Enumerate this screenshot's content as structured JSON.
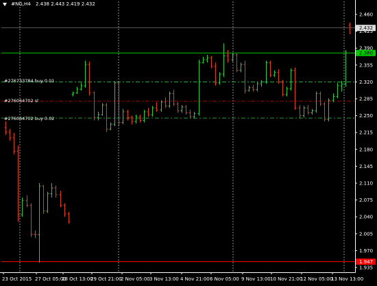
{
  "window": {
    "symbol": "#NG,H4",
    "ohlc": "2.438 2.443 2.419 2.432"
  },
  "colors": {
    "background": "#000000",
    "bull": "#2ecc40",
    "bear": "#e04020",
    "axis": "#ffffff",
    "order_line": "#2ecc40",
    "sl_line": "#cc0000",
    "current_line": "#e04020",
    "bid_line": "#00cc00",
    "ask_line": "#ff0000"
  },
  "order_lines": [
    {
      "label": "#276733784 buy 0.01",
      "price": 2.32,
      "kind": "order"
    },
    {
      "label": "#276064702 sl",
      "price": 2.28,
      "kind": "sl"
    },
    {
      "label": "#276064702 buy 0.02",
      "price": 2.245,
      "kind": "order"
    }
  ],
  "price_tags": {
    "current": {
      "text": "2.432",
      "price": 2.432
    },
    "green": {
      "text": "2.380",
      "price": 2.38
    },
    "red": {
      "text": "1.947",
      "price": 1.947
    }
  },
  "chart_data": {
    "type": "candlestick",
    "ylim": [
      1.925,
      2.47
    ],
    "y_ticks": [
      "2.460",
      "2.425",
      "2.390",
      "2.355",
      "2.320",
      "2.285",
      "2.250",
      "2.215",
      "2.180",
      "2.145",
      "2.110",
      "2.075",
      "2.040",
      "2.005",
      "1.970",
      "1.935"
    ],
    "x_labels": [
      "23 Oct 2015",
      "27 Oct 05:00",
      "28 Oct 13:00",
      "29 Oct 21:00",
      "2 Nov 05:00",
      "3 Nov 13:00",
      "4 Nov 21:00",
      "6 Nov 05:00",
      "9 Nov 13:00",
      "10 Nov 21:00",
      "12 Nov 05:00",
      "13 Nov 13:00"
    ],
    "period_separators": [
      "26 Oct 2015 00:00",
      "2 Nov 2015 00:00",
      "9 Nov 2015 00:00",
      "16 Nov 2015 00:00"
    ],
    "candles": [
      [
        2.225,
        2.238,
        2.21,
        2.216
      ],
      [
        2.216,
        2.222,
        2.198,
        2.204
      ],
      [
        2.204,
        2.214,
        2.17,
        2.176
      ],
      [
        2.176,
        2.188,
        2.03,
        2.045
      ],
      [
        2.045,
        2.08,
        2.04,
        2.074
      ],
      [
        2.074,
        2.085,
        2.06,
        2.064
      ],
      [
        2.064,
        2.068,
        1.998,
        2.004
      ],
      [
        2.004,
        2.012,
        1.996,
        2.003
      ],
      [
        2.003,
        2.11,
        1.945,
        2.104
      ],
      [
        2.104,
        2.106,
        2.046,
        2.052
      ],
      [
        2.052,
        2.092,
        2.048,
        2.088
      ],
      [
        2.088,
        2.11,
        2.08,
        2.1
      ],
      [
        2.1,
        2.105,
        2.08,
        2.086
      ],
      [
        2.086,
        2.094,
        2.06,
        2.064
      ],
      [
        2.064,
        2.068,
        2.04,
        2.046
      ],
      [
        2.046,
        2.05,
        2.026,
        2.03
      ],
      [
        2.294,
        2.3,
        2.29,
        2.297
      ],
      [
        2.297,
        2.31,
        2.295,
        2.305
      ],
      [
        2.305,
        2.318,
        2.302,
        2.312
      ],
      [
        2.312,
        2.364,
        2.308,
        2.356
      ],
      [
        2.356,
        2.362,
        2.292,
        2.298
      ],
      [
        2.298,
        2.3,
        2.24,
        2.246
      ],
      [
        2.246,
        2.258,
        2.24,
        2.252
      ],
      [
        2.252,
        2.276,
        2.25,
        2.272
      ],
      [
        2.272,
        2.276,
        2.216,
        2.222
      ],
      [
        2.222,
        2.236,
        2.22,
        2.232
      ],
      [
        2.232,
        2.322,
        2.228,
        2.318
      ],
      [
        2.318,
        2.322,
        2.228,
        2.236
      ],
      [
        2.236,
        2.264,
        2.232,
        2.258
      ],
      [
        2.258,
        2.262,
        2.24,
        2.246
      ],
      [
        2.246,
        2.25,
        2.232,
        2.238
      ],
      [
        2.238,
        2.252,
        2.234,
        2.248
      ],
      [
        2.248,
        2.252,
        2.236,
        2.24
      ],
      [
        2.24,
        2.262,
        2.236,
        2.258
      ],
      [
        2.258,
        2.266,
        2.248,
        2.252
      ],
      [
        2.252,
        2.27,
        2.248,
        2.266
      ],
      [
        2.266,
        2.278,
        2.258,
        2.262
      ],
      [
        2.262,
        2.282,
        2.258,
        2.278
      ],
      [
        2.278,
        2.288,
        2.266,
        2.27
      ],
      [
        2.27,
        2.3,
        2.266,
        2.296
      ],
      [
        2.296,
        2.304,
        2.27,
        2.274
      ],
      [
        2.274,
        2.278,
        2.256,
        2.26
      ],
      [
        2.26,
        2.272,
        2.256,
        2.268
      ],
      [
        2.268,
        2.272,
        2.252,
        2.256
      ],
      [
        2.256,
        2.262,
        2.244,
        2.248
      ],
      [
        2.248,
        2.258,
        2.244,
        2.254
      ],
      [
        2.254,
        2.366,
        2.25,
        2.36
      ],
      [
        2.36,
        2.372,
        2.358,
        2.366
      ],
      [
        2.366,
        2.376,
        2.36,
        2.37
      ],
      [
        2.37,
        2.374,
        2.348,
        2.352
      ],
      [
        2.352,
        2.36,
        2.312,
        2.318
      ],
      [
        2.318,
        2.34,
        2.314,
        2.336
      ],
      [
        2.336,
        2.4,
        2.33,
        2.374
      ],
      [
        2.374,
        2.386,
        2.36,
        2.366
      ],
      [
        2.366,
        2.38,
        2.362,
        2.376
      ],
      [
        2.376,
        2.38,
        2.34,
        2.344
      ],
      [
        2.344,
        2.36,
        2.34,
        2.356
      ],
      [
        2.356,
        2.364,
        2.296,
        2.302
      ],
      [
        2.302,
        2.312,
        2.3,
        2.308
      ],
      [
        2.308,
        2.314,
        2.3,
        2.304
      ],
      [
        2.304,
        2.32,
        2.3,
        2.316
      ],
      [
        2.316,
        2.324,
        2.31,
        2.32
      ],
      [
        2.32,
        2.364,
        2.316,
        2.36
      ],
      [
        2.36,
        2.364,
        2.33,
        2.334
      ],
      [
        2.334,
        2.344,
        2.33,
        2.34
      ],
      [
        2.34,
        2.346,
        2.316,
        2.32
      ],
      [
        2.32,
        2.324,
        2.29,
        2.294
      ],
      [
        2.294,
        2.31,
        2.29,
        2.306
      ],
      [
        2.306,
        2.348,
        2.302,
        2.344
      ],
      [
        2.344,
        2.35,
        2.262,
        2.266
      ],
      [
        2.266,
        2.272,
        2.244,
        2.25
      ],
      [
        2.25,
        2.27,
        2.246,
        2.266
      ],
      [
        2.266,
        2.272,
        2.252,
        2.256
      ],
      [
        2.256,
        2.264,
        2.252,
        2.26
      ],
      [
        2.26,
        2.3,
        2.256,
        2.296
      ],
      [
        2.296,
        2.3,
        2.27,
        2.274
      ],
      [
        2.274,
        2.278,
        2.238,
        2.242
      ],
      [
        2.242,
        2.286,
        2.238,
        2.282
      ],
      [
        2.282,
        2.296,
        2.278,
        2.29
      ],
      [
        2.29,
        2.318,
        2.286,
        2.312
      ],
      [
        2.312,
        2.322,
        2.3,
        2.316
      ],
      [
        2.316,
        2.386,
        2.31,
        2.38
      ],
      [
        2.438,
        2.443,
        2.419,
        2.432
      ]
    ]
  }
}
